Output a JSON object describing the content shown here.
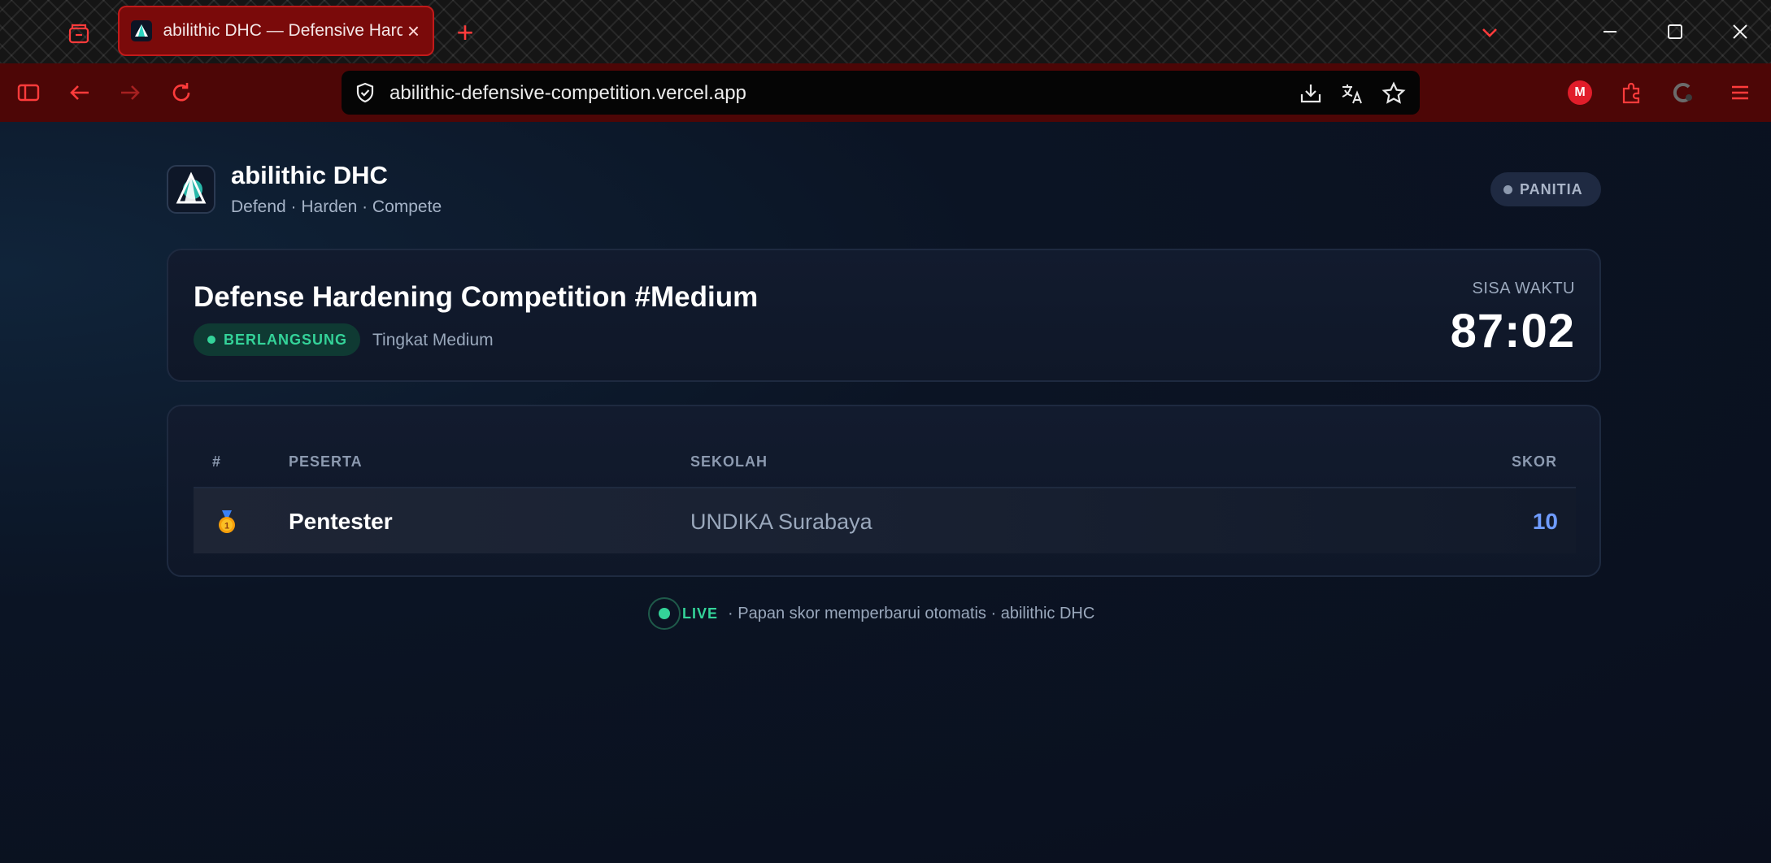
{
  "browser": {
    "tab": {
      "title": "abilithic DHC — Defensive Hardening Competition",
      "close": "×"
    },
    "new_tab": "+",
    "url": "abilithic-defensive-competition.vercel.app",
    "accent_color": "#ff3b3b",
    "profile_initial": "M",
    "icons": [
      "tab-groups-icon",
      "new-tab-icon",
      "list-tabs-icon",
      "minimize-icon",
      "maximize-icon",
      "close-icon",
      "sidebar-icon",
      "back-icon",
      "forward-icon",
      "reload-icon",
      "shield-icon",
      "download-icon",
      "translate-icon",
      "star-icon",
      "extensions-icon",
      "menu-icon"
    ]
  },
  "header": {
    "brand_name": "abilithic DHC",
    "tagline": "Defend · Harden · Compete",
    "role_badge": "PANITIA"
  },
  "competition": {
    "title": "Defense Hardening Competition #Medium",
    "status": "BERLANGSUNG",
    "level": "Tingkat Medium",
    "timer_label": "SISA WAKTU",
    "timer_value": "87:02",
    "status_color": "#34d399"
  },
  "scoreboard": {
    "columns": [
      "#",
      "PESERTA",
      "SEKOLAH",
      "SKOR"
    ],
    "rows": [
      {
        "rank_icon": "gold-medal-icon",
        "name": "Pentester",
        "school": "UNDIKA Surabaya",
        "score": "10"
      }
    ],
    "score_color": "#6f9cff"
  },
  "footer": {
    "live": "LIVE",
    "text": "· Papan skor memperbarui otomatis · abilithic DHC"
  }
}
